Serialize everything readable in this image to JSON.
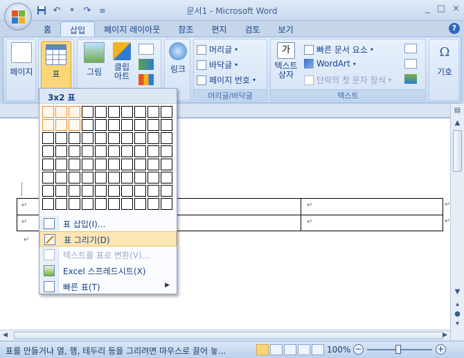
{
  "window": {
    "title": "문서1 - Microsoft Word",
    "controls": [
      "_",
      "□",
      "×"
    ]
  },
  "quick_access": {
    "items": [
      "save-icon",
      "undo-icon",
      "redo-icon",
      "customize-icon"
    ]
  },
  "tabs": [
    {
      "label": "홈"
    },
    {
      "label": "삽입",
      "active": true
    },
    {
      "label": "페이지 레이아웃"
    },
    {
      "label": "참조"
    },
    {
      "label": "편지"
    },
    {
      "label": "검토"
    },
    {
      "label": "보기"
    }
  ],
  "ribbon": {
    "pages": {
      "label": "페이지"
    },
    "table": {
      "label": "표"
    },
    "picture": {
      "label": "그림"
    },
    "clipart": {
      "label": "클립\n아트"
    },
    "link": {
      "label": "링크"
    },
    "header_footer": {
      "header": "머리글",
      "footer": "바닥글",
      "page_number": "페이지 번호",
      "group_label": "머리글/바닥글"
    },
    "text": {
      "textbox": "텍스트\n상자",
      "quick_parts": "빠른 문서 요소",
      "wordart": "WordArt",
      "dropcap": "단락의 첫 문자 장식",
      "group_label": "텍스트"
    },
    "symbol": {
      "label": "기호"
    }
  },
  "dropdown": {
    "title": "3x2 표",
    "grid": {
      "cols": 10,
      "rows": 8,
      "selected_cols": 3,
      "selected_rows": 2
    },
    "items": [
      {
        "label": "표 삽입(I)...",
        "icon": "insert-table-icon",
        "enabled": true,
        "hover": false
      },
      {
        "label": "표 그리기(D)",
        "icon": "draw-table-icon",
        "enabled": true,
        "hover": true
      },
      {
        "label": "텍스트를 표로 변환(V)...",
        "icon": "convert-text-icon",
        "enabled": false,
        "hover": false
      },
      {
        "label": "Excel 스프레드시트(X)",
        "icon": "excel-icon",
        "enabled": true,
        "hover": false
      },
      {
        "label": "빠른 표(T)",
        "icon": "quick-table-icon",
        "enabled": true,
        "hover": false,
        "submenu": true
      }
    ]
  },
  "status": {
    "text": "표를 만들거나 열, 행, 테두리 등을 그리려면 마우스로 끌어 놓...",
    "zoom": "100%",
    "zoom_minus": "−",
    "zoom_plus": "+"
  },
  "colors": {
    "accent": "#15428b",
    "ribbon": "#d5e3f5",
    "selection": "#f08b1e"
  }
}
